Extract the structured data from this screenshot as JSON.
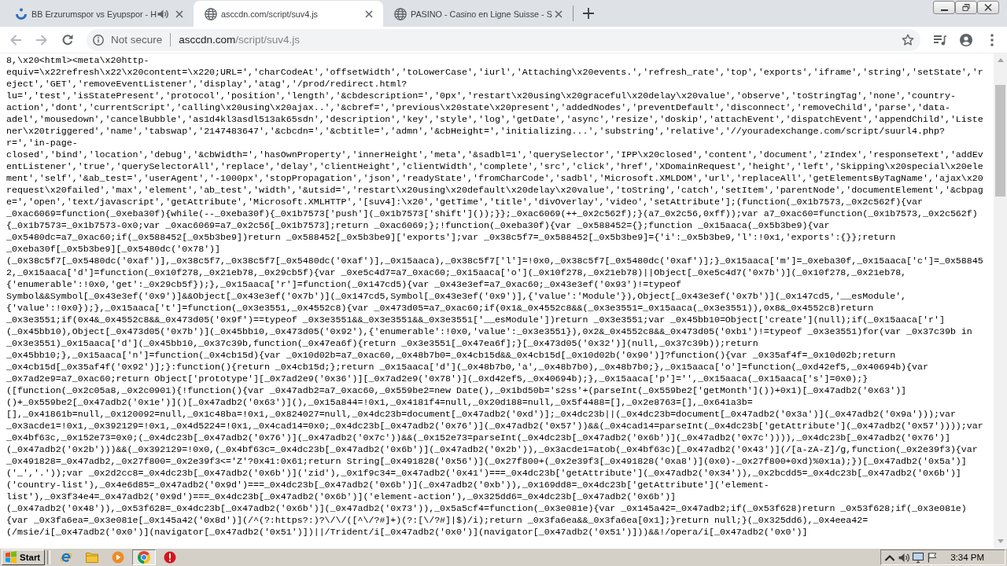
{
  "window": {
    "tabs": [
      {
        "title": "BB Erzurumspor vs Eyupspor - H",
        "kind": "logo",
        "audio": true,
        "selected": false
      },
      {
        "title": "asccdn.com/script/suv4.js",
        "kind": "globe",
        "audio": false,
        "selected": true
      },
      {
        "title": "PASINO - Casino en Ligne Suisse - S",
        "kind": "globe",
        "audio": false,
        "selected": false
      }
    ]
  },
  "toolbar": {
    "back": {
      "disabled": true
    },
    "forward": {
      "disabled": true
    },
    "security": "Not secure",
    "url": {
      "host": "asccdn.com",
      "path": "/script/suv4.js"
    }
  },
  "code": {
    "lines": [
      "8,\\x20<html><meta\\x20http-",
      "equiv=\\x22refresh\\x22\\x20content=\\x220;URL=','charCodeAt','offsetWidth','toLowerCase','iurl','Attaching\\x20events.','refresh_rate','top','exports','iframe','string','setState','r",
      "eject','GET','removeEventListener','display','atag','/prod/redirect.html?",
      "lu=','test','isStatePresent','protocol','position','length','&cbdescription=','0px','restart\\x20using\\x20graceful\\x20delay\\x20value','observe','toStringTag','none','country-",
      "action','dont','currentScript','calling\\x20using\\x20ajax..','&cbref=','previous\\x20state\\x20present','addedNodes','preventDefault','disconnect','removeChild','parse','data-",
      "adel','mousedown','cancelBubble','as1d4kl3asdl513ak65sdn','description','key','style','log','getDate','async','resize','doskip','attachEvent','dispatchEvent','appendChild','Liste",
      "ner\\x20triggered','name','tabswap','2147483647','&cbcdn=','&cbtitle=','admn','&cbHeight=','initializing...','substring','relative','//youradexchange.com/script/suurl4.php?",
      "r=','in-page-",
      "closed','bind','location','debug','&cbWidth=','hasOwnProperty','innerHeight','meta','&sadbl=1','querySelector','IPP\\x20closed','content','document','zIndex','responseText','addEv",
      "entListener','true','querySelectorAll','replace','delay','clientHeight','clientWidth','complete','src','click','href','XDomainRequest','height','left','Skipping\\x20special\\x20ele",
      "ment','self','&ab_test=','userAgent','-1000px','stopPropagation','json','readyState','fromCharCode','sadbl','Microsoft.XMLDOM','url','replaceAll','getElementsByTagName','ajax\\x20",
      "request\\x20failed','max','element','ab_test','width','&utsid=','restart\\x20using\\x20default\\x20delay\\x20value','toString','catch','setItem','parentNode','documentElement','&cbpag",
      "e=','open','text/javascript','getAttribute','Microsoft.XMLHTTP','[suv4]:\\x20','getTime','title','divOverlay','video','setAttribute'];(function(_0x1b7573,_0x2c562f){var",
      "_0xac6069=function(_0xeba30f){while(--_0xeba30f){_0x1b7573['push'](_0x1b7573['shift']());}};_0xac6069(++_0x2c562f);}(a7_0x2c56,0xff));var a7_0xac60=function(_0x1b7573,_0x2c562f)",
      "{_0x1b7573=_0x1b7573-0x0;var _0xac6069=a7_0x2c56[_0x1b7573];return _0xac6069;};!function(_0xeba30f){var _0x588452={};function _0x15aaca(_0x5b3be9){var",
      "_0x5480dc=a7_0xac60;if(_0x588452[_0x5b3be9])return _0x588452[_0x5b3be9]['exports'];var _0x38c5f7=_0x588452[_0x5b3be9]={'i':_0x5b3be9,'l':!0x1,'exports':{}};return",
      "_0xeba30f[_0x5b3be9][_0x5480dc('0x78')]",
      "(_0x38c5f7[_0x5480dc('0xaf')],_0x38c5f7,_0x38c5f7[_0x5480dc('0xaf')],_0x15aaca),_0x38c5f7['l']=!0x0,_0x38c5f7[_0x5480dc('0xaf')];}_0x15aaca['m']=_0xeba30f,_0x15aaca['c']=_0x58845",
      "2,_0x15aaca['d']=function(_0x10f278,_0x21eb78,_0x29cb5f){var _0xe5c4d7=a7_0xac60;_0x15aaca['o'](_0x10f278,_0x21eb78)||Object[_0xe5c4d7('0x7b')](_0x10f278,_0x21eb78,",
      "{'enumerable':!0x0,'get':_0x29cb5f});},_0x15aaca['r']=function(_0x147cd5){var _0x43e3ef=a7_0xac60;_0x43e3ef('0x93')!=typeof",
      "Symbol&&Symbol[_0x43e3ef('0x9')]&&Object[_0x43e3ef('0x7b')](_0x147cd5,Symbol[_0x43e3ef('0x9')],{'value':'Module'}),Object[_0x43e3ef('0x7b')](_0x147cd5,'__esModule',",
      "{'value':!0x0});},_0x15aaca['t']=function(_0x3e3551,_0x4552c8){var _0x473d05=a7_0xac60;if(0x1&_0x4552c8&&(_0x3e3551=_0x15aaca(_0x3e3551)),0x8&_0x4552c8)return",
      "_0x3e3551;if(0x4&_0x4552c8&&_0x473d05('0x9f')==typeof _0x3e3551&&_0x3e3551&&_0x3e3551['__esModule'])return _0x3e3551;var _0x45bb10=Object['create'](null);if(_0x15aaca['r']",
      "(_0x45bb10),Object[_0x473d05('0x7b')](_0x45bb10,_0x473d05('0x92'),{'enumerable':!0x0,'value':_0x3e3551}),0x2&_0x4552c8&&_0x473d05('0xb1')!=typeof _0x3e3551)for(var _0x37c39b in",
      "_0x3e3551)_0x15aaca['d'](_0x45bb10,_0x37c39b,function(_0x47ea6f){return _0x3e3551[_0x47ea6f];}[_0x473d05('0x32')](null,_0x37c39b));return",
      "_0x45bb10;},_0x15aaca['n']=function(_0x4cb15d){var _0x10d02b=a7_0xac60,_0x48b7b0=_0x4cb15d&&_0x4cb15d[_0x10d02b('0x90')]?function(){var _0x35af4f=_0x10d02b;return",
      "_0x4cb15d[_0x35af4f('0x92')];}:function(){return _0x4cb15d;};return _0x15aaca['d'](_0x48b7b0,'a',_0x48b7b0),_0x48b7b0;},_0x15aaca['o']=function(_0xd42ef5,_0x40694b){var",
      "_0x7ad2e9=a7_0xac60;return Object['prototype'][_0x7ad2e9('0x36')][_0x7ad2e9('0x78')](_0xd42ef5,_0x40694b);},_0x15aaca['p']='',_0x15aaca(_0x15aaca['s']=0x0);}",
      "([function(_0x2c05a8,_0x2c0901){!function(){var _0x47adb2=a7_0xac60,_0x559be2=new Date(),_0x1bd50b='s2ss'+(parseInt(_0x559be2['getMonth']())+0x1)[_0x47adb2('0x63')]",
      "()+_0x559be2[_0x47adb2('0x1e')]()[_0x47adb2('0x63')](),_0x15a844=!0x1,_0x4181f4=null,_0x20d188=null,_0x5f4488=[],_0x2e8763=[],_0x641a3b=",
      "[],_0x41861b=null,_0x120092=null,_0x1c48ba=!0x1,_0x824027=null,_0x4dc23b=document[_0x47adb2('0xd')];_0x4dc23b||(_0x4dc23b=document[_0x47adb2('0x3a')](_0x47adb2('0x9a')));var",
      "_0x3acde1=!0x1,_0x392129=!0x1,_0x4d5224=!0x1,_0x4cad14=0x0;_0x4dc23b[_0x47adb2('0x76')](_0x47adb2('0x57'))&&(_0x4cad14=parseInt(_0x4dc23b['getAttribute'](_0x47adb2('0x57'))));var",
      "_0x4bf63c,_0x152e73=0x0;(_0x4dc23b[_0x47adb2('0x76')](_0x47adb2('0x7c'))&&(_0x152e73=parseInt(_0x4dc23b[_0x47adb2('0x6b')](_0x47adb2('0x7c')))),_0x4dc23b[_0x47adb2('0x76')]",
      "(_0x47adb2('0x2b')))&&(_0x392129=!0x0,(_0x4bf63c=_0x4dc23b[_0x47adb2('0x6b')](_0x47adb2('0x2b')),_0x3acde1=atob(_0x4bf63c)[_0x47adb2('0x43')](/[a-zA-Z]/g,function(_0x2e39f3){var",
      "_0x491828=_0x47adb2,_0x27f800=_0x2e39f3<='Z'?0x41:0x61;return String[_0x491828('0x56')](_0x27f800+(_0x2e39f3[_0x491828('0xa8')](0x0)-_0x27f800+0xd)%0x1a);})[_0x47adb2('0x5a')]",
      "('_','.'));var _0x2d2cc8=_0x4dc23b[_0x47adb2('0x6b')]('zid'),_0x1f9c34=_0x47adb2('0x41')===_0x4dc23b['getAttribute'](_0x47adb2('0x34')),_0x2bcdd5=_0x4dc23b[_0x47adb2('0x6b')]",
      "('country-list'),_0x4e6d85=_0x47adb2('0x9d')===_0x4dc23b[_0x47adb2('0x6b')](_0x47adb2('0xb')),_0x169dd8=_0x4dc23b['getAttribute']('element-",
      "list'),_0x3f34e4=_0x47adb2('0x9d')===_0x4dc23b[_0x47adb2('0x6b')]('element-action'),_0x325dd6=_0x4dc23b[_0x47adb2('0x6b')]",
      "(_0x47adb2('0x48')),_0x53f628=_0x4dc23b[_0x47adb2('0x6b')](_0x47adb2('0x73')),_0x5a5cf4=function(_0x3e081e){var _0x145a42=_0x47adb2;if(_0x53f628)return _0x53f628;if(_0x3e081e)",
      "{var _0x3fa6ea=_0x3e081e[_0x145a42('0x8d')](/^(?:https?:)?\\/\\/([^\\/?#]+)(?:[\\/?#]|$)/i);return _0x3fa6ea&&_0x3fa6ea[0x1];}return null;}(_0x325dd6),_0x4eea42=",
      "(/msie/i[_0x47adb2('0x0')](navigator[_0x47adb2('0x51')])||/Trident/i[_0x47adb2('0x0')](navigator[_0x47adb2('0x51')]))&&!/opera/i[_0x47adb2('0x0')]"
    ]
  },
  "taskbar": {
    "start": "Start",
    "apps": [
      {
        "kind": "e-logo",
        "selected": false
      },
      {
        "kind": "folder",
        "selected": false
      },
      {
        "kind": "player",
        "selected": false
      },
      {
        "kind": "round-logo",
        "selected": true
      },
      {
        "kind": "alert",
        "selected": false
      }
    ],
    "clock": "3:34 PM"
  }
}
